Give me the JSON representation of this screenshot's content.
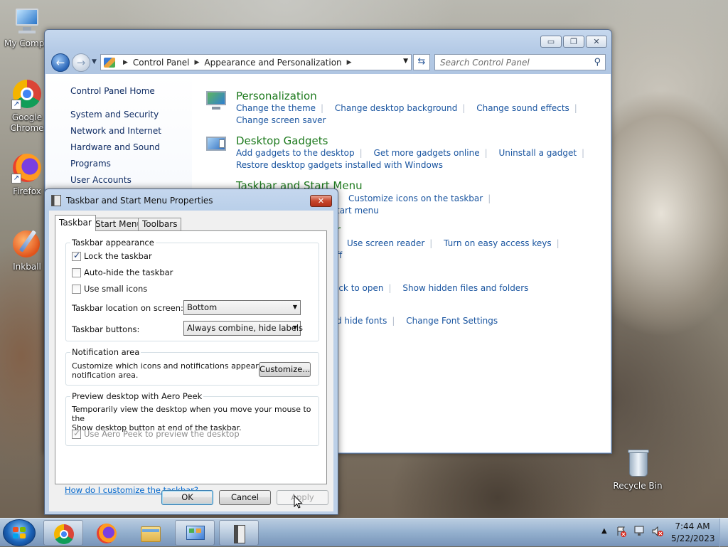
{
  "desktop": {
    "icons": [
      {
        "label": "My Compu"
      },
      {
        "label": "Google Chrome"
      },
      {
        "label": "Firefox"
      },
      {
        "label": "Inkball"
      },
      {
        "label": "Recycle Bin"
      }
    ]
  },
  "control_panel": {
    "address": {
      "segments": [
        "Control Panel",
        "Appearance and Personalization"
      ]
    },
    "search_placeholder": "Search Control Panel",
    "sidebar": {
      "home": "Control Panel Home",
      "items": [
        "System and Security",
        "Network and Internet",
        "Hardware and Sound",
        "Programs",
        "User Accounts"
      ]
    },
    "categories": [
      {
        "title": "Personalization",
        "links": [
          "Change the theme",
          "Change desktop background",
          "Change sound effects",
          "Change screen saver"
        ]
      },
      {
        "title": "Desktop Gadgets",
        "links": [
          "Add gadgets to the desktop",
          "Get more gadgets online",
          "Uninstall a gadget",
          "Restore desktop gadgets installed with Windows"
        ]
      },
      {
        "title": "Taskbar and Start Menu",
        "links": [
          "Customize icons on the taskbar",
          "tart menu"
        ]
      },
      {
        "title": "r",
        "links": [
          "Use screen reader",
          "Turn on easy access keys",
          "ff"
        ]
      },
      {
        "title": "",
        "links": [
          "ick to open",
          "Show hidden files and folders"
        ]
      },
      {
        "title": "",
        "links": [
          "d hide fonts",
          "Change Font Settings"
        ]
      }
    ]
  },
  "dialog": {
    "title": "Taskbar and Start Menu Properties",
    "tabs": [
      "Taskbar",
      "Start Menu",
      "Toolbars"
    ],
    "taskbar_appearance": {
      "title": "Taskbar appearance",
      "lock": {
        "label": "Lock the taskbar",
        "checked": true
      },
      "autohide": {
        "label": "Auto-hide the taskbar",
        "checked": false
      },
      "small_icons": {
        "label": "Use small icons",
        "checked": false
      },
      "location_label": "Taskbar location on screen:",
      "location_value": "Bottom",
      "buttons_label": "Taskbar buttons:",
      "buttons_value": "Always combine, hide labels"
    },
    "notification": {
      "title": "Notification area",
      "desc_line1": "Customize which icons and notifications appear in the",
      "desc_line2": "notification area.",
      "customize": "Customize..."
    },
    "aero_peek": {
      "title": "Preview desktop with Aero Peek",
      "desc_line1": "Temporarily view the desktop when you move your mouse to the",
      "desc_line2": "Show desktop button at end of the taskbar.",
      "checkbox": {
        "label": "Use Aero Peek to preview the desktop",
        "checked": true
      }
    },
    "help_link": "How do I customize the taskbar?",
    "ok": "OK",
    "cancel": "Cancel",
    "apply": "Apply"
  },
  "taskbar": {
    "clock_time": "7:44 AM",
    "clock_date": "5/22/2023"
  }
}
